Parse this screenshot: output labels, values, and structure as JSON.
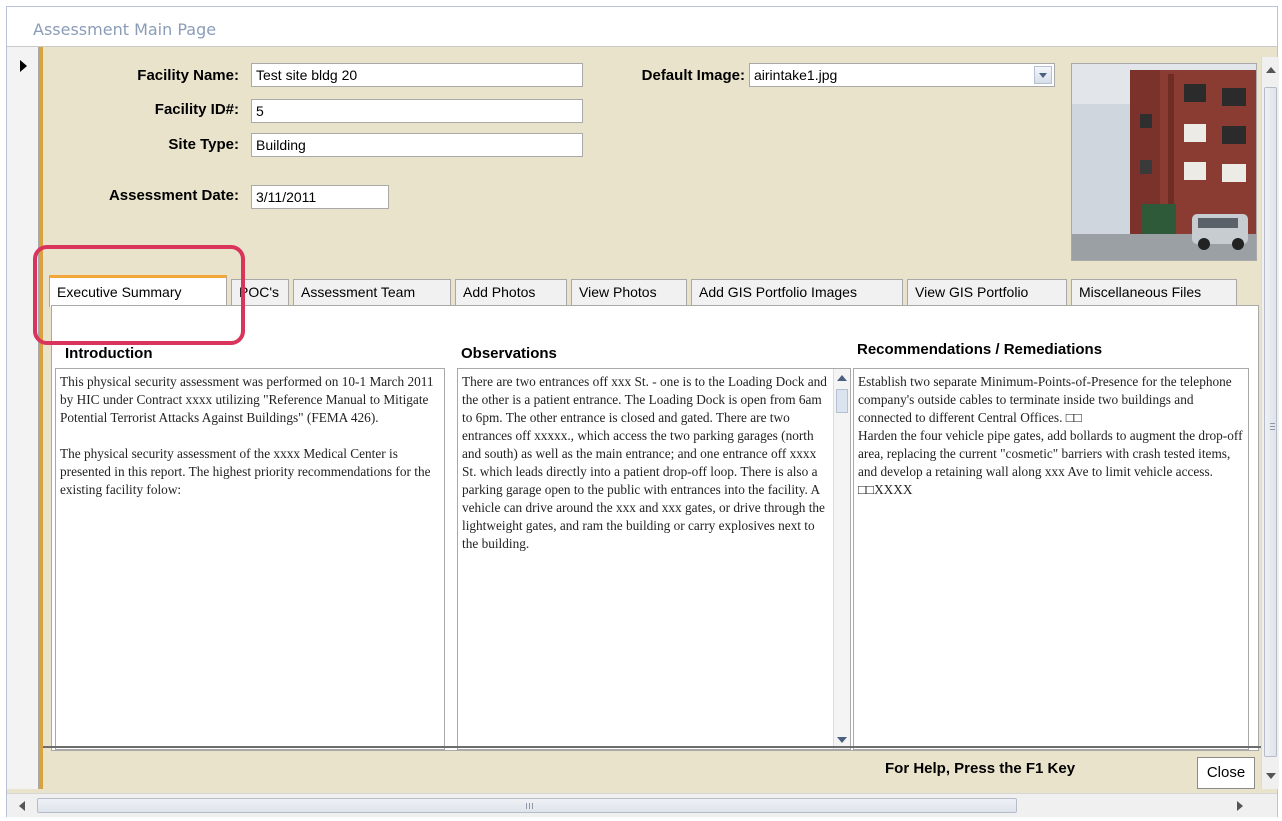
{
  "window": {
    "title": "Assessment Main Page"
  },
  "header": {
    "facility_name_label": "Facility Name:",
    "facility_name_value": "Test site bldg 20",
    "facility_id_label": "Facility ID#:",
    "facility_id_value": "5",
    "site_type_label": "Site Type:",
    "site_type_value": "Building",
    "assessment_date_label": "Assessment Date:",
    "assessment_date_value": "3/11/2011",
    "default_image_label": "Default Image:",
    "default_image_value": "airintake1.jpg"
  },
  "tabs": [
    {
      "label": "Executive Summary",
      "active": true
    },
    {
      "label": "POC's"
    },
    {
      "label": "Assessment Team"
    },
    {
      "label": "Add Photos"
    },
    {
      "label": "View Photos"
    },
    {
      "label": "Add GIS Portfolio Images"
    },
    {
      "label": "View GIS Portfolio"
    },
    {
      "label": "Miscellaneous Files"
    }
  ],
  "sections": {
    "introduction": {
      "heading": "Introduction",
      "text": "This physical security assessment was performed on 10-1 March 2011 by HIC under Contract xxxx utilizing \"Reference Manual to Mitigate Potential Terrorist Attacks Against Buildings\" (FEMA 426).\n\nThe physical security assessment of the xxxx Medical Center is presented in this report. The highest priority recommendations for the existing facility folow:"
    },
    "observations": {
      "heading": "Observations",
      "text": "There are two entrances off xxx St. - one is to the Loading Dock and the other is a patient entrance. The Loading Dock is open from 6am to 6pm. The other entrance is closed and gated. There are two entrances off xxxxx., which access the two parking garages (north and south) as well as the main entrance; and one entrance off xxxx St. which leads directly into a patient drop-off loop. There is also a parking garage open to the public with entrances into the facility. A vehicle can drive around the xxx and xxx gates, or drive through the lightweight gates, and ram the building or carry explosives next to the building."
    },
    "recommendations": {
      "heading": "Recommendations / Remediations",
      "text": "Establish two separate Minimum-Points-of-Presence for the telephone company's outside cables to terminate inside two buildings and connected to different Central Offices. □□\nHarden the four vehicle pipe gates, add bollards to augment the drop-off area, replacing the current \"cosmetic\" barriers with crash tested items, and develop a retaining wall along xxx Ave to limit vehicle access. □□XXXX"
    }
  },
  "footer": {
    "help_text": "For Help, Press the F1 Key",
    "close_label": "Close"
  },
  "icons": [
    "record-selector-arrow-icon",
    "dropdown-arrow-icon",
    "scroll-up-icon",
    "scroll-down-icon",
    "scroll-left-icon",
    "scroll-right-icon"
  ],
  "colors": {
    "form_background": "#e9e3cc",
    "active_tab_accent": "#f3a73a",
    "callout_outline": "#d9345b",
    "title_text": "#8a9cb8"
  }
}
